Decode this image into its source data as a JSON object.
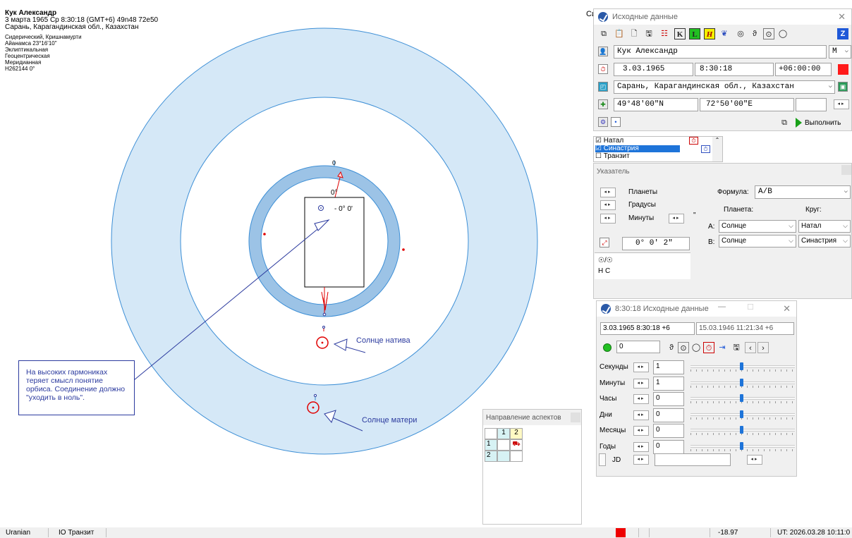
{
  "chart_info": {
    "name": "Кук Александр",
    "line1": "3 марта 1965  Ср   8:30:18 (GMT+6) 49n48  72e50",
    "line2": "Сарань, Карагандинская обл., Казахстан",
    "settings": [
      "Сидерический, Кришнамурти",
      "Айанамса 23°16'10\"",
      "Эклиптикальная",
      "Геоцентрическая",
      "Меридианная",
      "H262144  0°"
    ]
  },
  "wheel": {
    "label_top": "0",
    "label_zero": "0°",
    "box_value": "- 0° 0'",
    "colors": {
      "outer_ring": "#d5e8f7",
      "outline": "#3d8fd6",
      "inner_band": "#9cc3e6",
      "marker": "#e00000",
      "arrow": "#2b3a9e"
    }
  },
  "annotations": {
    "sun_native": "Солнце натива",
    "sun_mother": "Солнце матери",
    "note": "На высоких гармониках теряет смысл понятие орбиса. Соединение должно \"уходить в ноль\"."
  },
  "cropped_title": "Cи",
  "input_window": {
    "title": "Исходные данные",
    "toolbar_icons": [
      "copy-icon",
      "paste-icon",
      "new-file-icon",
      "save-icon",
      "list-icon",
      "k-icon",
      "l-icon",
      "h-icon",
      "heart-icon",
      "moon-icon",
      "saturn-icon",
      "sun-icon",
      "circle-icon",
      "z-icon"
    ],
    "name": "Кук Александр",
    "gender": "М",
    "date": "3.03.1965",
    "time": "8:30:18",
    "tz": "+06:00:00",
    "place": "Сарань, Карагандинская обл., Казахстан",
    "lat": "49°48'00\"N",
    "lon": "72°50'00\"E",
    "execute": "Выполнить"
  },
  "chart_list": {
    "items": [
      {
        "label": "Натал",
        "checked": true
      },
      {
        "label": "Синастрия",
        "checked": true
      },
      {
        "label": "Транзит",
        "checked": false
      }
    ]
  },
  "pointer_window": {
    "title": "Указатель",
    "planets": "Планеты",
    "degrees": "Градусы",
    "minutes": "Минуты",
    "minutes_mark": "\"",
    "formula_label": "Формула:",
    "formula": "A/B",
    "planet_label": "Планета:",
    "circle_label": "Круг:",
    "a_label": "A:",
    "b_label": "B:",
    "a_planet": "Солнце",
    "b_planet": "Солнце",
    "a_circle": "Натал",
    "b_circle": "Синастрия",
    "value": "0°  0'  2\"",
    "list": [
      "☉/☉",
      "Н  С"
    ]
  },
  "transit_window": {
    "title": "8:30:18 Исходные данные",
    "date1": "3.03.1965  8:30:18 +6",
    "date2": "15.03.1946  11:21:34 +6",
    "step_value": "0",
    "rows": [
      {
        "label": "Секунды",
        "value": "1"
      },
      {
        "label": "Минуты",
        "value": "1"
      },
      {
        "label": "Часы",
        "value": "0"
      },
      {
        "label": "Дни",
        "value": "0"
      },
      {
        "label": "Месяцы",
        "value": "0"
      },
      {
        "label": "Годы",
        "value": "0"
      }
    ],
    "jd_label": "JD"
  },
  "aspects_window": {
    "title": "Направление аспектов",
    "col1": "1",
    "col2": "2",
    "row1": "1",
    "row2": "2"
  },
  "statusbar": {
    "app": "Uranian",
    "mode": "IO Транзит",
    "value": "-18.97",
    "ut": "UT: 2026.03.28 10:11:0"
  }
}
